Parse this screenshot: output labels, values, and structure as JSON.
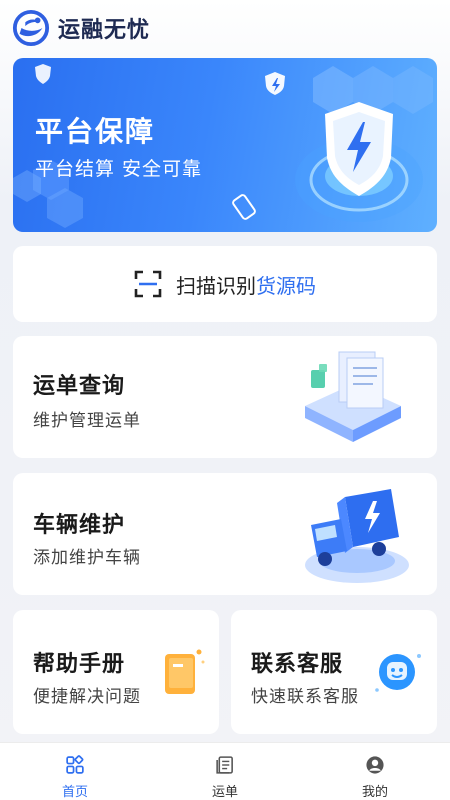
{
  "header": {
    "app_name": "运融无忧"
  },
  "banner": {
    "title": "平台保障",
    "subtitle": "平台结算  安全可靠"
  },
  "scan": {
    "prefix": "扫描识别",
    "highlight": "货源码"
  },
  "cards": {
    "waybill": {
      "title": "运单查询",
      "subtitle": "维护管理运单"
    },
    "vehicle": {
      "title": "车辆维护",
      "subtitle": "添加维护车辆"
    },
    "help": {
      "title": "帮助手册",
      "subtitle": "便捷解决问题"
    },
    "service": {
      "title": "联系客服",
      "subtitle": "快速联系客服"
    }
  },
  "tabbar": {
    "items": [
      {
        "label": "首页",
        "icon": "home-grid-icon",
        "active": true
      },
      {
        "label": "运单",
        "icon": "document-list-icon",
        "active": false
      },
      {
        "label": "我的",
        "icon": "person-icon",
        "active": false
      }
    ]
  },
  "colors": {
    "accent": "#2f6ff0",
    "banner_start": "#2a6ff0",
    "banner_end": "#5fb0ff"
  }
}
